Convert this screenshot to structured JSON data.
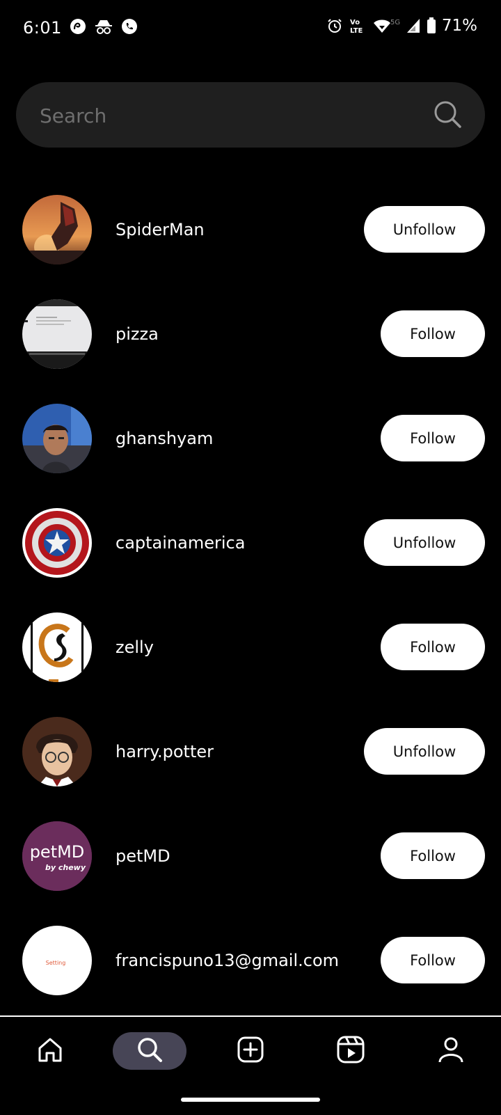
{
  "status_bar": {
    "time": "6:01",
    "network_label": "5G",
    "volte_label": "Vo LTE",
    "battery": "71%"
  },
  "search": {
    "placeholder": "Search",
    "value": ""
  },
  "users": [
    {
      "name": "SpiderMan",
      "button": "Unfollow",
      "avatar": "spiderman-avatar"
    },
    {
      "name": "pizza",
      "button": "Follow",
      "avatar": "screen-photo-avatar"
    },
    {
      "name": "ghanshyam",
      "button": "Follow",
      "avatar": "selfie-avatar"
    },
    {
      "name": "captainamerica",
      "button": "Unfollow",
      "avatar": "shield-avatar"
    },
    {
      "name": "zelly",
      "button": "Follow",
      "avatar": "letter-logo-avatar"
    },
    {
      "name": "harry.potter",
      "button": "Unfollow",
      "avatar": "portrait-avatar"
    },
    {
      "name": "petMD",
      "button": "Follow",
      "avatar": "petmd-logo-avatar",
      "logo_text": "petMD",
      "logo_sub": "by chewy"
    },
    {
      "name": "francispuno13@gmail.com",
      "button": "Follow",
      "avatar": "setting-avatar",
      "avatar_text": "Setting"
    }
  ],
  "nav": {
    "items": [
      {
        "name": "home",
        "icon": "home-icon",
        "active": false
      },
      {
        "name": "search",
        "icon": "search-icon",
        "active": true
      },
      {
        "name": "create",
        "icon": "add-square-icon",
        "active": false
      },
      {
        "name": "reels",
        "icon": "reels-icon",
        "active": false
      },
      {
        "name": "profile",
        "icon": "profile-icon",
        "active": false
      }
    ]
  },
  "colors": {
    "background": "#000000",
    "search_bg": "#1f1f1f",
    "button_bg": "#ffffff",
    "nav_active": "#474556",
    "petmd_purple": "#6b2d5c"
  }
}
